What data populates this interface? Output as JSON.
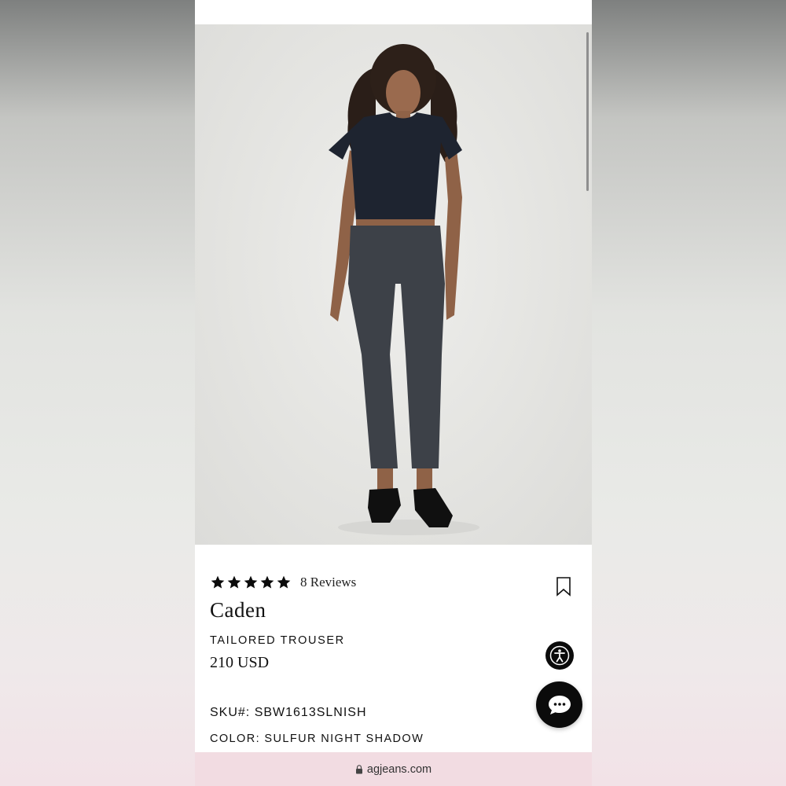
{
  "product": {
    "rating": 5,
    "reviews_label": "8 Reviews",
    "name": "Caden",
    "category": "TAILORED TROUSER",
    "price": "210 USD",
    "sku": "SKU#: SBW1613SLNISH",
    "color": "COLOR: SULFUR NIGHT SHADOW"
  },
  "browser": {
    "url": "agjeans.com"
  },
  "icons": {
    "bookmark": "bookmark-icon",
    "accessibility": "accessibility-icon",
    "chat": "chat-bubble-icon",
    "lock": "lock-icon",
    "star": "star-icon"
  },
  "colors": {
    "accent": "#0b0b0b",
    "url_bar": "#f2dce2",
    "hero_bg": "#e6e6e3"
  }
}
